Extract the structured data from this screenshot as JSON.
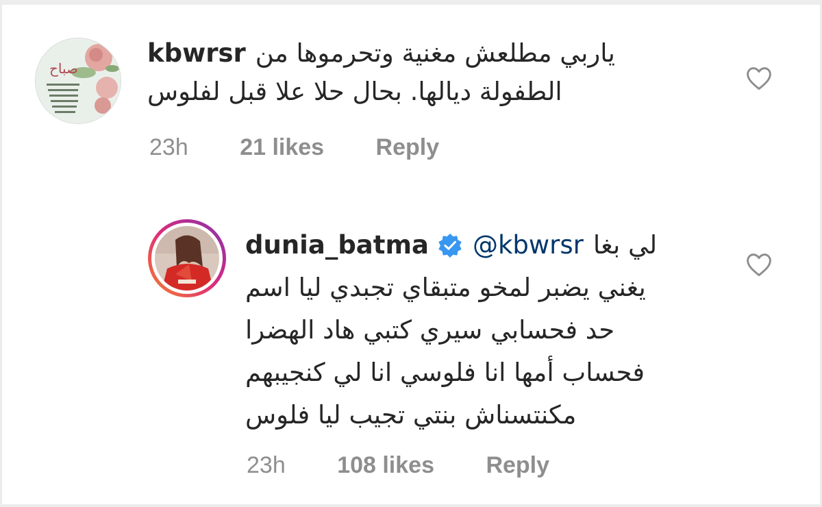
{
  "comments": [
    {
      "username": "kbwrsr",
      "text_line1": "ياربي  مطلعش مغنية  وتحرموها من",
      "text_line2": "الطفولة ديالها. بحال حلا علا قبل لفلوس",
      "time": "23h",
      "likes": "21 likes",
      "reply": "Reply",
      "avatar_caption": "صباح"
    },
    {
      "username": "dunia_batma",
      "mention": "@kbwrsr",
      "text_first": "لي بغا",
      "text_lines": [
        "يغني يضبر لمخو متبقاي تجبدي ليا اسم",
        "حد فحسابي سيري كتبي هاد الهضرا",
        "فحساب أمها انا فلوسي انا لي كنجيبهم",
        "مكنتسناش بنتي تجيب ليا فلوس"
      ],
      "time": "23h",
      "likes": "108 likes",
      "reply": "Reply",
      "verified": true
    }
  ],
  "colors": {
    "text": "#262626",
    "meta": "#8e8e8e",
    "mention": "#00376b",
    "verified": "#3897f0",
    "story_ring_start": "#f58529",
    "story_ring_end": "#dd2a7b"
  },
  "icons": {
    "like": "heart-outline-icon",
    "verified": "verified-badge-icon"
  }
}
